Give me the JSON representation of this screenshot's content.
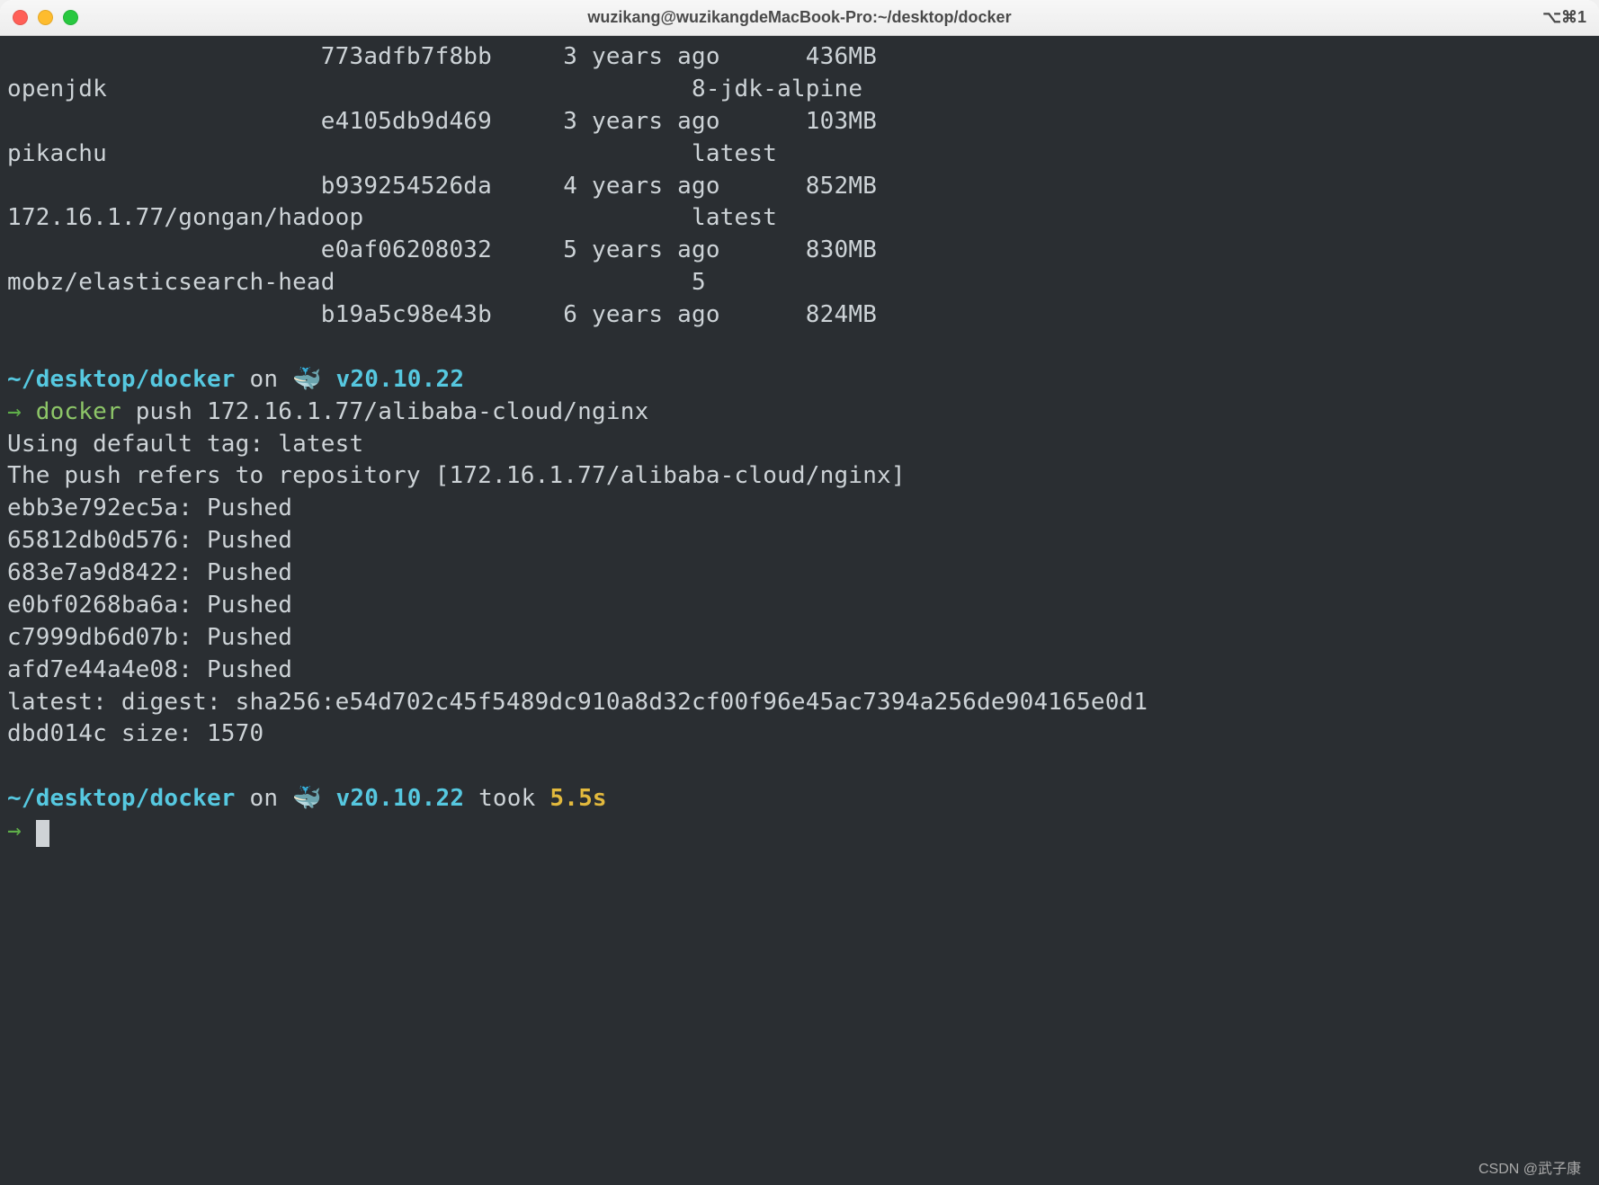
{
  "window": {
    "title": "wuzikang@wuzikangdeMacBook-Pro:~/desktop/docker",
    "shortcut": "⌥⌘1"
  },
  "images": [
    {
      "repo": "",
      "tag": "",
      "id": "773adfb7f8bb",
      "created": "3 years ago",
      "size": "436MB"
    },
    {
      "repo": "openjdk",
      "tag": "8-jdk-alpine",
      "id": "e4105db9d469",
      "created": "3 years ago",
      "size": "103MB"
    },
    {
      "repo": "pikachu",
      "tag": "latest",
      "id": "b939254526da",
      "created": "4 years ago",
      "size": "852MB"
    },
    {
      "repo": "172.16.1.77/gongan/hadoop",
      "tag": "latest",
      "id": "e0af06208032",
      "created": "5 years ago",
      "size": "830MB"
    },
    {
      "repo": "mobz/elasticsearch-head",
      "tag": "5",
      "id": "b19a5c98e43b",
      "created": "6 years ago",
      "size": "824MB"
    }
  ],
  "prompt1": {
    "path": "~/desktop/docker",
    "on": "on",
    "whale": "🐳",
    "version": "v20.10.22",
    "arrow": "→",
    "cmd_name": "docker",
    "cmd_args": "push 172.16.1.77/alibaba-cloud/nginx"
  },
  "push_output": {
    "l1": "Using default tag: latest",
    "l2": "The push refers to repository [172.16.1.77/alibaba-cloud/nginx]",
    "layers": [
      "ebb3e792ec5a: Pushed",
      "65812db0d576: Pushed",
      "683e7a9d8422: Pushed",
      "e0bf0268ba6a: Pushed",
      "c7999db6d07b: Pushed",
      "afd7e44a4e08: Pushed"
    ],
    "digest": "latest: digest: sha256:e54d702c45f5489dc910a8d32cf00f96e45ac7394a256de904165e0d1dbd014c size: 1570"
  },
  "prompt2": {
    "path": "~/desktop/docker",
    "on": "on",
    "whale": "🐳",
    "version": "v20.10.22",
    "took": "took",
    "duration": "5.5s",
    "arrow": "→"
  },
  "watermark": "CSDN @武子康"
}
